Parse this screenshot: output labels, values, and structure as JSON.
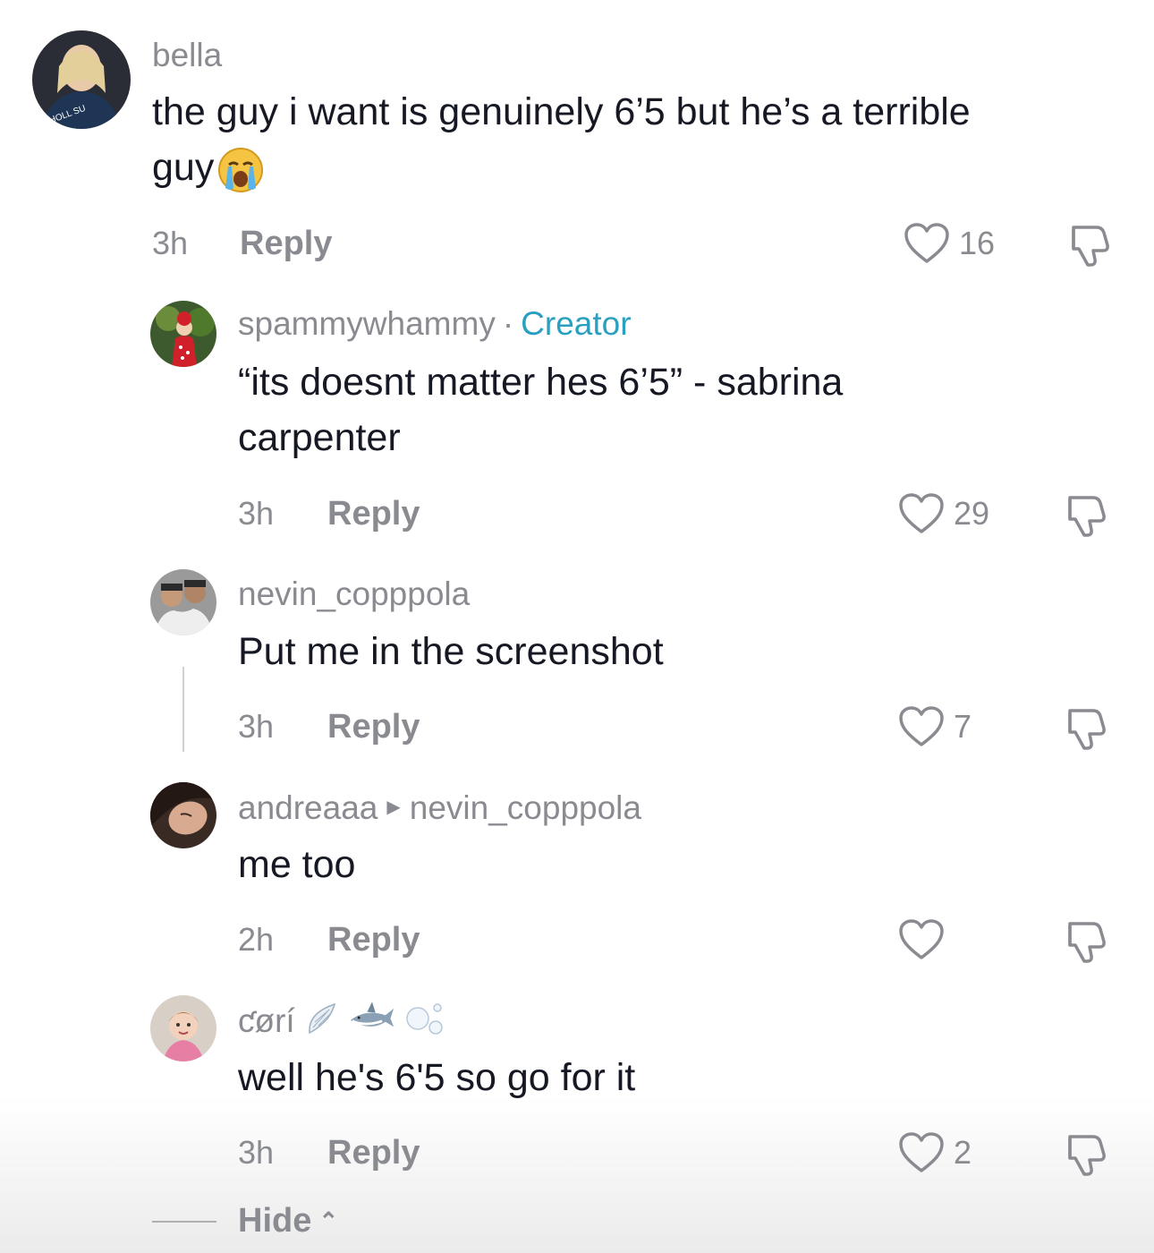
{
  "comments": [
    {
      "username": "bella",
      "text": "the guy i want is genuinely 6’5 but he’s a terrible guy",
      "text_line1": "the guy i want is genuinely 6’5 but he’s a terrible",
      "text_line2": "guy",
      "emoji": "loudly-crying-face",
      "time": "3h",
      "reply_label": "Reply",
      "likes": "16"
    },
    {
      "username": "spammywhammy",
      "separator": "·",
      "badge": "Creator",
      "text_line1": "“its doesnt matter hes 6’5” - sabrina",
      "text_line2": "carpenter",
      "time": "3h",
      "reply_label": "Reply",
      "likes": "29"
    },
    {
      "username": "nevin_copppola",
      "text": "Put me in the screenshot",
      "time": "3h",
      "reply_label": "Reply",
      "likes": "7"
    },
    {
      "username": "andreaaa",
      "reply_to": "nevin_copppola",
      "text": "me too",
      "time": "2h",
      "reply_label": "Reply",
      "likes": ""
    },
    {
      "username": "ƈørí",
      "username_emoji": [
        "wing",
        "shark",
        "bubbles"
      ],
      "text": "well he's 6'5 so go for it",
      "time": "3h",
      "reply_label": "Reply",
      "likes": "2"
    }
  ],
  "hide_label": "Hide",
  "colors": {
    "text": "#161823",
    "muted": "#8a8b91",
    "creator": "#2b9fbf"
  }
}
